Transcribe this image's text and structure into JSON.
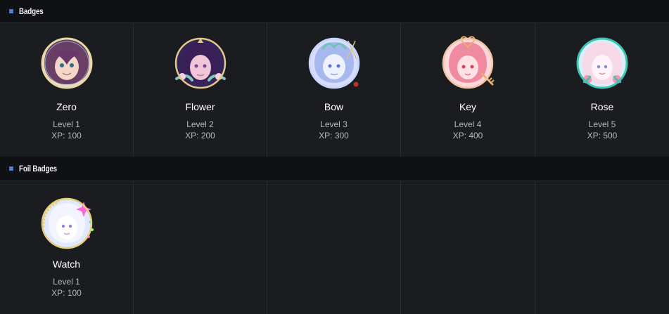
{
  "sections": [
    {
      "title": "Badges",
      "badges": [
        {
          "name": "Zero",
          "level": "Level 1",
          "xp": "XP: 100",
          "icon": "zero-badge-icon",
          "colors": {
            "hair": "#5a2f5a",
            "skin": "#f4d7c8",
            "ring": "#e8d9a4",
            "accent": "#9ad3e6"
          }
        },
        {
          "name": "Flower",
          "level": "Level 2",
          "xp": "XP: 200",
          "icon": "flower-badge-icon",
          "colors": {
            "hair": "#3a1f58",
            "skin": "#f0c7d8",
            "ring": "#e1c98c",
            "accent": "#7ec7b8"
          }
        },
        {
          "name": "Bow",
          "level": "Level 3",
          "xp": "XP: 300",
          "icon": "bow-badge-icon",
          "colors": {
            "hair": "#a7b8ef",
            "skin": "#eef2ff",
            "ring": "#c7d7ff",
            "accent": "#d7c08a"
          }
        },
        {
          "name": "Key",
          "level": "Level 4",
          "xp": "XP: 400",
          "icon": "key-badge-icon",
          "colors": {
            "hair": "#f08aa0",
            "skin": "#ffe1e6",
            "ring": "#f2c5a1",
            "accent": "#e7b06f"
          }
        },
        {
          "name": "Rose",
          "level": "Level 5",
          "xp": "XP: 500",
          "icon": "rose-badge-icon",
          "colors": {
            "hair": "#f6d8e6",
            "skin": "#fff3f7",
            "ring": "#3fc4b2",
            "accent": "#ff8fb1"
          }
        }
      ]
    },
    {
      "title": "Foil Badges",
      "badges": [
        {
          "name": "Watch",
          "level": "Level 1",
          "xp": "XP: 100",
          "icon": "watch-badge-icon",
          "colors": {
            "hair": "#f2f5ff",
            "skin": "#ffffff",
            "ring": "#e7d07a",
            "accent": "#ff67d8"
          }
        },
        null,
        null,
        null,
        null
      ]
    }
  ]
}
